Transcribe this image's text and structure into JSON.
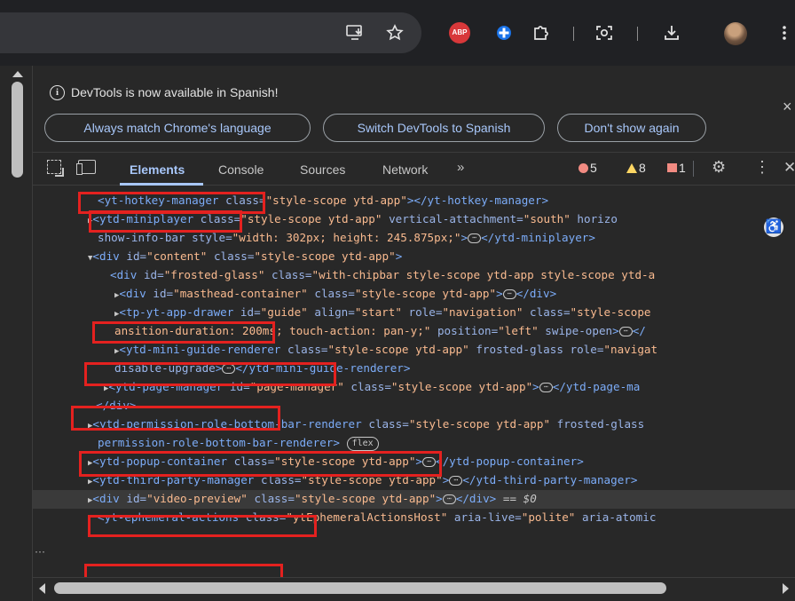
{
  "toolbar": {
    "icons": [
      "install-app-icon",
      "bookmark-star-icon",
      "adblock-plus-icon",
      "extension-icon",
      "extensions-puzzle-icon",
      "screenshot-lens-icon",
      "download-icon",
      "profile-avatar",
      "menu-kebab-icon"
    ],
    "abp_label": "ABP"
  },
  "infobar": {
    "message": "DevTools is now available in Spanish!",
    "buttons": {
      "match": "Always match Chrome's language",
      "switch": "Switch DevTools to Spanish",
      "dismiss": "Don't show again"
    },
    "close": "×"
  },
  "tabs": {
    "elements": "Elements",
    "console": "Console",
    "sources": "Sources",
    "network": "Network",
    "more": "»"
  },
  "counters": {
    "errors": "5",
    "warnings": "8",
    "issues": "1"
  },
  "gutter": "···",
  "tree": {
    "r1": {
      "tag": "<yt-hotkey-manager",
      "attr": "class=",
      "val": "\"style-scope ytd-app\"",
      "close": "></yt-hotkey-manager>"
    },
    "r2": {
      "tag": "<ytd-miniplayer",
      "attr": "class=",
      "val": "\"style-scope ytd-app\"",
      "attr2": "vertical-attachment=",
      "val2": "\"south\"",
      "attr3": "horizo"
    },
    "r3": {
      "attr": "show-info-bar",
      "attr2": "style=",
      "val": "\"width: 302px; height: 245.875px;\"",
      "close": "</ytd-miniplayer>"
    },
    "r4": {
      "tag": "<div",
      "attr": "id=",
      "val": "\"content\"",
      "attr2": "class=",
      "val2": "\"style-scope ytd-app\"",
      "end": ">"
    },
    "r5": {
      "tag": "<div",
      "attr": "id=",
      "val": "\"frosted-glass\"",
      "attr2": "class=",
      "val2": "\"with-chipbar style-scope ytd-app style-scope ytd-a"
    },
    "r6": {
      "tag": "<div",
      "attr": "id=",
      "val": "\"masthead-container\"",
      "attr2": "class=",
      "val2": "\"style-scope ytd-app\"",
      "close": "</div>"
    },
    "r7": {
      "tag": "<tp-yt-app-drawer",
      "attr": "id=",
      "val": "\"guide\"",
      "attr2": "align=",
      "val2": "\"start\"",
      "attr3": "role=",
      "val3": "\"navigation\"",
      "attr4": "class=",
      "val4": "\"style-scope"
    },
    "r8": {
      "val": "ansition-duration: 200ms; touch-action: pan-y;\"",
      "attr": "position=",
      "val2": "\"left\"",
      "attr2": "swipe-open",
      "close": "</"
    },
    "r9": {
      "tag": "<ytd-mini-guide-renderer",
      "attr": "class=",
      "val": "\"style-scope ytd-app\"",
      "attr2": "frosted-glass",
      "attr3": "role=",
      "val3": "\"navigat"
    },
    "r10": {
      "attr": "disable-upgrade",
      "close": "</ytd-mini-guide-renderer>"
    },
    "r11": {
      "tag": "<ytd-page-manager",
      "attr": "id=",
      "val": "\"page-manager\"",
      "attr2": "class=",
      "val2": "\"style-scope ytd-app\"",
      "close": "</ytd-page-ma"
    },
    "r12": {
      "tag": "</div>"
    },
    "r13": {
      "tag": "<ytd-permission-role-bottom-bar-renderer",
      "attr": "class=",
      "val": "\"style-scope ytd-app\"",
      "attr2": "frosted-glass"
    },
    "r14": {
      "tag": "permission-role-bottom-bar-renderer>",
      "badge": "flex"
    },
    "r15": {
      "tag": "<ytd-popup-container",
      "attr": "class=",
      "val": "\"style-scope ytd-app\"",
      "close": "</ytd-popup-container>"
    },
    "r16": {
      "tag": "<ytd-third-party-manager",
      "attr": "class=",
      "val": "\"style-scope ytd-app\"",
      "close": "</ytd-third-party-manager>"
    },
    "r17": {
      "tag": "<div",
      "attr": "id=",
      "val": "\"video-preview\"",
      "attr2": "class=",
      "val2": "\"style-scope ytd-app\"",
      "close": "</div>",
      "eq": "== $0"
    },
    "r18": {
      "tag": "<yt-ephemeral-actions",
      "attr": "class=",
      "val": "\"ytEphemeralActionsHost\"",
      "attr2": "aria-live=",
      "val2": "\"polite\"",
      "attr3": "aria-atomic"
    }
  },
  "ellipsis": "⋯"
}
